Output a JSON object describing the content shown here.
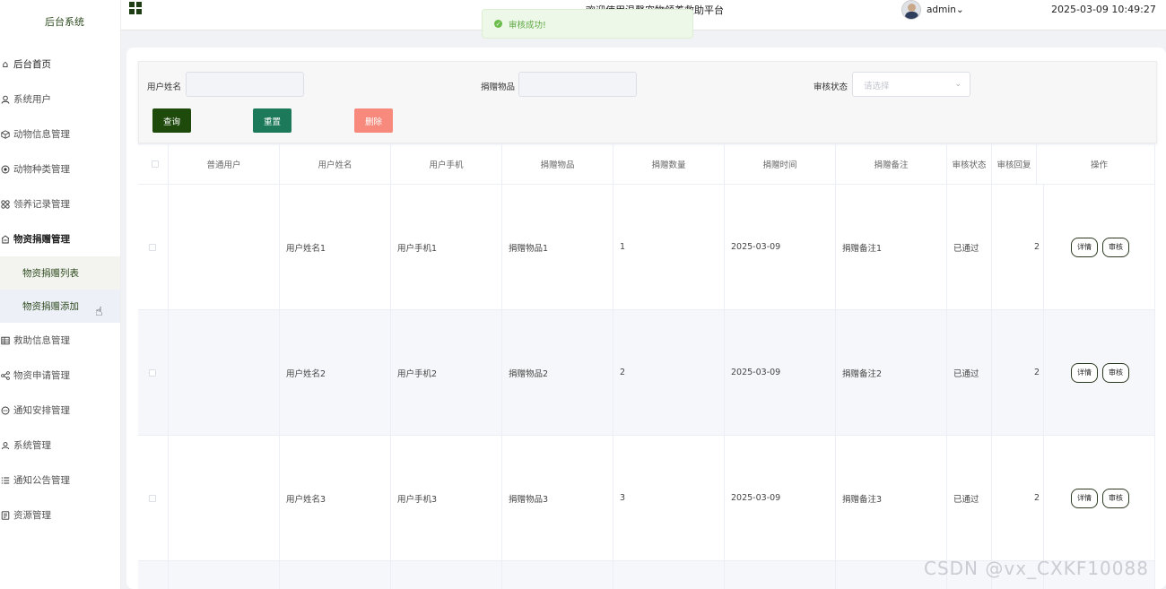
{
  "sidebar": {
    "brand": "后台系统",
    "items": [
      {
        "label": "后台首页",
        "icon": "home-icon"
      },
      {
        "label": "系统用户",
        "icon": "user-icon"
      },
      {
        "label": "动物信息管理",
        "icon": "box-icon"
      },
      {
        "label": "动物种类管理",
        "icon": "target-icon"
      },
      {
        "label": "领养记录管理",
        "icon": "grid-icon"
      },
      {
        "label": "物资捐赠管理",
        "icon": "donation-icon"
      }
    ],
    "submenu": [
      {
        "label": "物资捐赠列表"
      },
      {
        "label": "物资捐赠添加"
      }
    ],
    "items_after": [
      {
        "label": "救助信息管理",
        "icon": "table-icon"
      },
      {
        "label": "物资申请管理",
        "icon": "share-icon"
      },
      {
        "label": "通知安排管理",
        "icon": "chat-icon"
      },
      {
        "label": "系统管理",
        "icon": "users-icon"
      },
      {
        "label": "通知公告管理",
        "icon": "list-icon"
      },
      {
        "label": "资源管理",
        "icon": "file-icon"
      }
    ]
  },
  "header": {
    "welcome": "欢迎使用温馨宠物领养救助平台",
    "user": "admin",
    "datetime": "2025-03-09 10:49:27"
  },
  "toast": {
    "text": "审核成功!"
  },
  "search": {
    "name_label": "用户姓名",
    "item_label": "捐赠物品",
    "status_label": "审核状态",
    "status_placeholder": "请选择",
    "query_btn": "查询",
    "reset_btn": "重置",
    "delete_btn": "删除"
  },
  "colors": {
    "query": "#1e4a0c",
    "reset": "#1c7a5a",
    "delete": "#f78a7d"
  },
  "table": {
    "headers": [
      "普通用户",
      "用户姓名",
      "用户手机",
      "捐赠物品",
      "捐赠数量",
      "捐赠时间",
      "捐赠备注",
      "审核状态",
      "审核回复",
      "操作"
    ],
    "rows": [
      {
        "name": "用户姓名1",
        "phone": "用户手机1",
        "item": "捐赠物品1",
        "qty": "1",
        "date": "2025-03-09",
        "note": "捐赠备注1",
        "status": "已通过",
        "reply": "2"
      },
      {
        "name": "用户姓名2",
        "phone": "用户手机2",
        "item": "捐赠物品2",
        "qty": "2",
        "date": "2025-03-09",
        "note": "捐赠备注2",
        "status": "已通过",
        "reply": "2"
      },
      {
        "name": "用户姓名3",
        "phone": "用户手机3",
        "item": "捐赠物品3",
        "qty": "3",
        "date": "2025-03-09",
        "note": "捐赠备注3",
        "status": "已通过",
        "reply": "2"
      }
    ],
    "detail_btn": "详情",
    "audit_btn": "审核"
  },
  "watermark": "CSDN @vx_CXKF10088"
}
